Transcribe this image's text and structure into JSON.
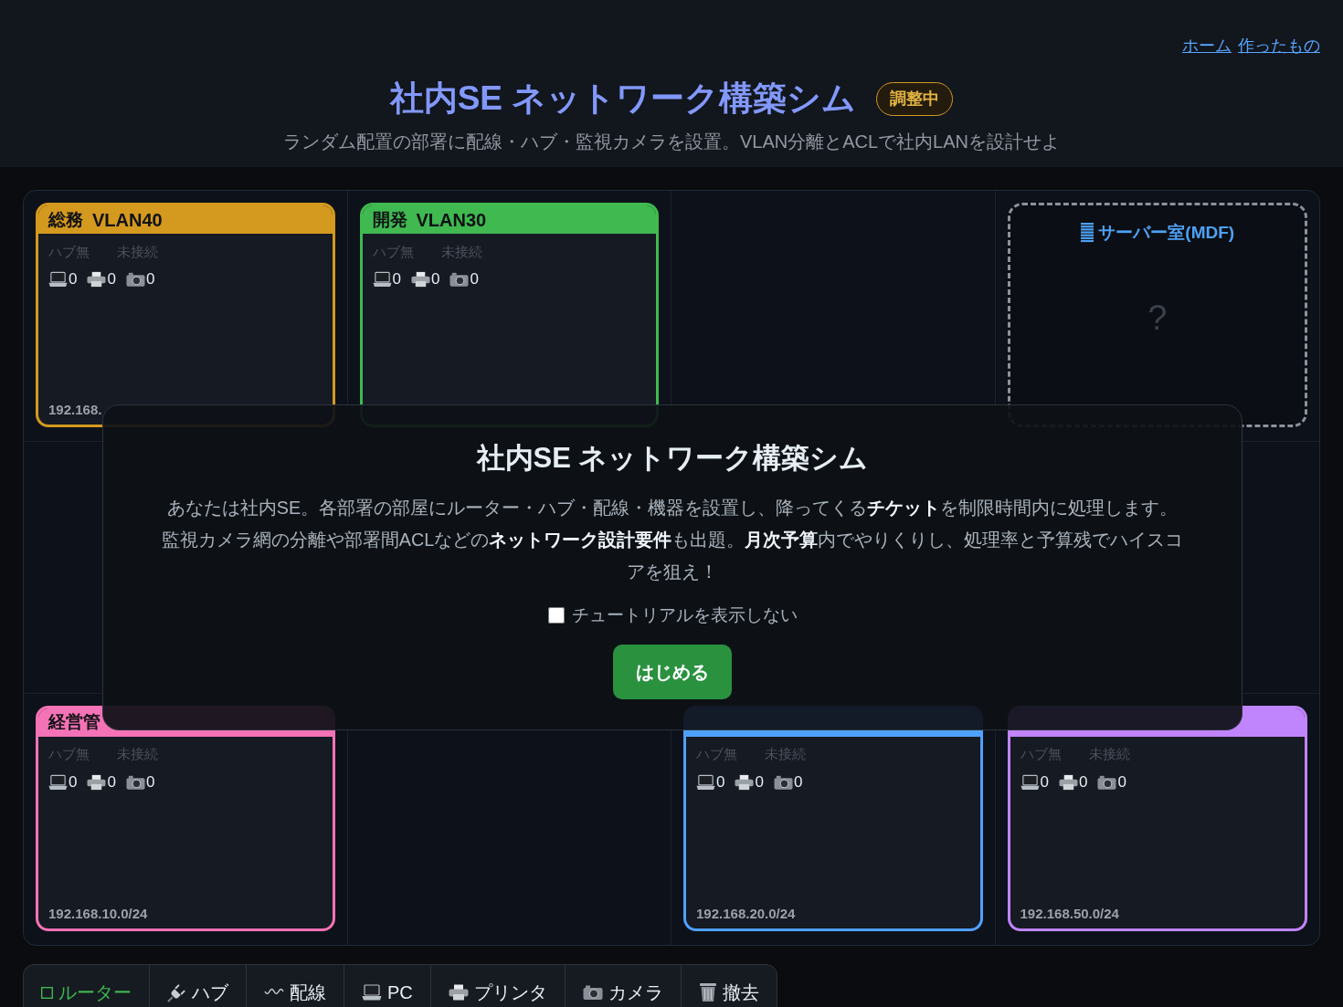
{
  "nav_links": [
    {
      "label": "ホーム"
    },
    {
      "label": "作ったもの"
    }
  ],
  "header": {
    "title": "社内SE ネットワーク構築シム",
    "badge": "調整中",
    "subtitle": "ランダム配置の部署に配線・ハブ・監視カメラを設置。VLAN分離とACLで社内LANを設計せよ"
  },
  "board": {
    "cells": [
      {
        "kind": "room",
        "name": "総務",
        "vlan": "VLAN40",
        "color": "#d4991f",
        "hub_status": "ハブ無",
        "link_status": "未接続",
        "devices": [
          {
            "kind": "pc",
            "count": "0"
          },
          {
            "kind": "printer",
            "count": "0"
          },
          {
            "kind": "camera",
            "count": "0"
          }
        ],
        "subnet": "192.168."
      },
      {
        "kind": "room",
        "name": "開発",
        "vlan": "VLAN30",
        "color": "#3fb950",
        "hub_status": "ハブ無",
        "link_status": "未接続",
        "devices": [
          {
            "kind": "pc",
            "count": "0"
          },
          {
            "kind": "printer",
            "count": "0"
          },
          {
            "kind": "camera",
            "count": "0"
          }
        ]
      },
      {
        "kind": "empty"
      },
      {
        "kind": "server_room",
        "title": "サーバー室(MDF)",
        "mark": "?"
      },
      {
        "kind": "empty"
      },
      {
        "kind": "empty"
      },
      {
        "kind": "empty"
      },
      {
        "kind": "empty"
      },
      {
        "kind": "room",
        "name": "経営管",
        "color": "#f472b6",
        "hub_status": "ハブ無",
        "link_status": "未接続",
        "devices": [
          {
            "kind": "pc",
            "count": "0"
          },
          {
            "kind": "printer",
            "count": "0"
          },
          {
            "kind": "camera",
            "count": "0"
          }
        ],
        "subnet": "192.168.10.0/24"
      },
      {
        "kind": "empty"
      },
      {
        "kind": "room",
        "color": "#4ea1ff",
        "hub_status": "ハブ無",
        "link_status": "未接続",
        "devices": [
          {
            "kind": "pc",
            "count": "0"
          },
          {
            "kind": "printer",
            "count": "0"
          },
          {
            "kind": "camera",
            "count": "0"
          }
        ],
        "subnet": "192.168.20.0/24"
      },
      {
        "kind": "room",
        "color": "#c084fc",
        "hub_status": "ハブ無",
        "link_status": "未接続",
        "devices": [
          {
            "kind": "pc",
            "count": "0"
          },
          {
            "kind": "printer",
            "count": "0"
          },
          {
            "kind": "camera",
            "count": "0"
          }
        ],
        "subnet": "192.168.50.0/24"
      }
    ]
  },
  "modal": {
    "title": "社内SE ネットワーク構築シム",
    "body": "あなたは社内SE。各部署の部屋にルーター・ハブ・配線・機器を設置し、降ってくる**チケット**を制限時間内に処理します。監視カメラ網の分離や部署間ACLなどの**ネットワーク設計要件**も出題。**月次予算**内でやりくりし、処理率と予算残でハイスコアを狙え！",
    "checkbox": {
      "label": "チュートリアルを表示しない",
      "checked": false
    },
    "button": "はじめる"
  },
  "tools": [
    {
      "kind": "router",
      "label": "ルーター",
      "selected": true
    },
    {
      "kind": "hub",
      "label": "ハブ",
      "selected": false
    },
    {
      "kind": "cable",
      "label": "配線",
      "selected": false
    },
    {
      "kind": "pc",
      "label": "PC",
      "selected": false
    },
    {
      "kind": "printer",
      "label": "プリンタ",
      "selected": false
    },
    {
      "kind": "camera",
      "label": "カメラ",
      "selected": false
    },
    {
      "kind": "remove",
      "label": "撤去",
      "selected": false
    }
  ]
}
